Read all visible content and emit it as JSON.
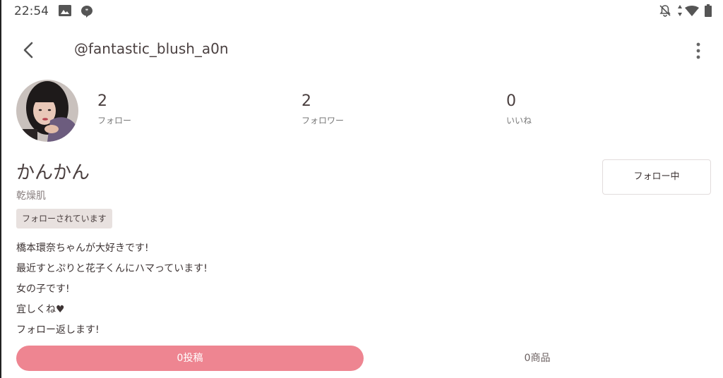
{
  "status_bar": {
    "time": "22:54",
    "left_icons": [
      "image-icon",
      "chat-bubble-icon"
    ],
    "right_icons": [
      "bell-off-icon",
      "data-arrows-icon",
      "wifi-icon",
      "battery-icon"
    ]
  },
  "header": {
    "username": "@fantastic_blush_a0n",
    "back_icon": "chevron-left-icon",
    "more_icon": "more-vertical-icon"
  },
  "profile": {
    "stats": [
      {
        "value": "2",
        "label": "フォロー"
      },
      {
        "value": "2",
        "label": "フォロワー"
      },
      {
        "value": "0",
        "label": "いいね"
      }
    ],
    "display_name": "かんかん",
    "skin_type": "乾燥肌",
    "follows_you_badge": "フォローされています",
    "following_button": "フォロー中",
    "bio": [
      "橋本環奈ちゃんが大好きです!",
      "最近すとぷりと花子くんにハマっています!",
      "女の子です!",
      "宜しくね♥",
      "フォロー返します!"
    ]
  },
  "tabs": {
    "posts": "0投稿",
    "items": "0商品"
  },
  "colors": {
    "accent": "#ee8591",
    "badge_bg": "#e8e1df",
    "text": "#4a3f3f"
  }
}
